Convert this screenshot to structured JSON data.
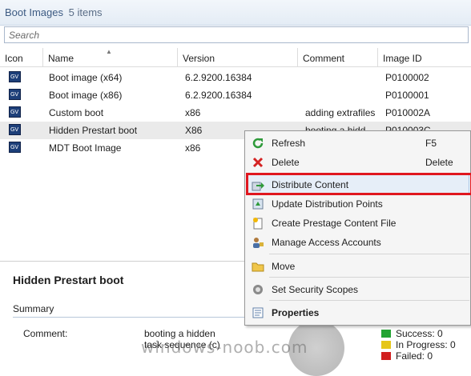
{
  "header": {
    "title": "Boot Images",
    "count": "5 items"
  },
  "search": {
    "placeholder": "Search"
  },
  "columns": [
    "Icon",
    "Name",
    "Version",
    "Comment",
    "Image ID"
  ],
  "rows": [
    {
      "name": "Boot image (x64)",
      "version": "6.2.9200.16384",
      "comment": "",
      "image_id": "P0100002"
    },
    {
      "name": "Boot image (x86)",
      "version": "6.2.9200.16384",
      "comment": "",
      "image_id": "P0100001"
    },
    {
      "name": "Custom boot",
      "version": "x86",
      "comment": "adding extrafiles",
      "image_id": "P010002A"
    },
    {
      "name": "Hidden Prestart boot",
      "version": "X86",
      "comment": "booting a hidd",
      "image_id": "P010003C"
    },
    {
      "name": "MDT Boot Image",
      "version": "x86",
      "comment": "",
      "image_id": ""
    }
  ],
  "context_menu": {
    "items": [
      {
        "label": "Refresh",
        "shortcut": "F5",
        "icon": "refresh-icon"
      },
      {
        "label": "Delete",
        "shortcut": "Delete",
        "icon": "delete-icon"
      },
      {
        "label": "Distribute Content",
        "shortcut": "",
        "icon": "distribute-content-icon"
      },
      {
        "label": "Update Distribution Points",
        "shortcut": "",
        "icon": "update-distribution-points-icon"
      },
      {
        "label": "Create Prestage Content File",
        "shortcut": "",
        "icon": "prestage-file-icon"
      },
      {
        "label": "Manage Access Accounts",
        "shortcut": "",
        "icon": "accounts-icon"
      },
      {
        "label": "Move",
        "shortcut": "",
        "icon": "folder-icon"
      },
      {
        "label": "Set Security Scopes",
        "shortcut": "",
        "icon": "lock-icon"
      },
      {
        "label": "Properties",
        "shortcut": "",
        "icon": "properties-icon"
      }
    ]
  },
  "details": {
    "title": "Hidden Prestart boot",
    "section": "Summary",
    "comment_label": "Comment:",
    "comment_value": "booting a hidden task sequence (c)"
  },
  "status_legend": [
    {
      "label": "Success: 0",
      "color": "#22a332"
    },
    {
      "label": "In Progress: 0",
      "color": "#e6c619"
    },
    {
      "label": "Failed: 0",
      "color": "#d11f1f"
    }
  ],
  "watermark": "windows-noob.com"
}
